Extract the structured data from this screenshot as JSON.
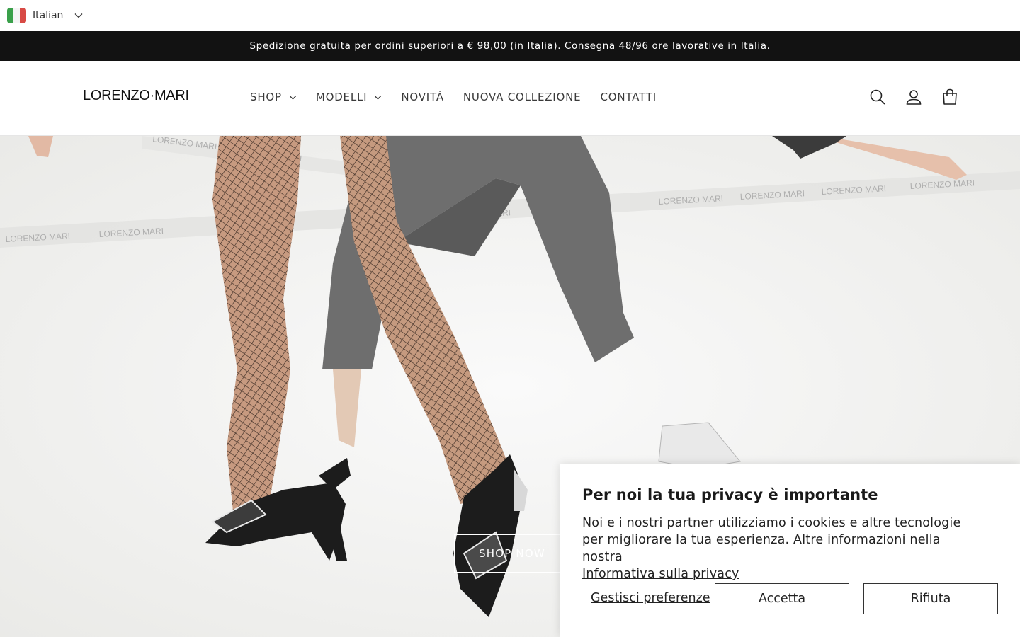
{
  "language": {
    "label": "Italian",
    "flag_colors": [
      "#3aa04a",
      "#f4f4f4",
      "#d84a45"
    ]
  },
  "announcement": {
    "text": "Spedizione gratuita per ordini superiori a € 98,00 (in Italia). Consegna 48/96 ore lavorative in Italia."
  },
  "header": {
    "logo": "LORENZO·MARI",
    "nav": [
      {
        "label": "SHOP",
        "has_dropdown": true
      },
      {
        "label": "MODELLI",
        "has_dropdown": true
      },
      {
        "label": "NOVITÀ",
        "has_dropdown": false
      },
      {
        "label": "NUOVA COLLEZIONE",
        "has_dropdown": false
      },
      {
        "label": "CONTATTI",
        "has_dropdown": false
      }
    ],
    "icons": [
      "search-icon",
      "account-icon",
      "cart-icon"
    ]
  },
  "hero": {
    "cta_label": "SHOP NOW",
    "tape_text": "LORENZO MARI"
  },
  "cookie_banner": {
    "title": "Per noi la tua privacy è importante",
    "body": "Noi e i nostri partner utilizziamo i cookies e altre tecnologie per migliorare la tua esperienza. Altre informazioni nella nostra",
    "link": "Informativa sulla privacy",
    "manage_label": "Gestisci preferenze",
    "accept_label": "Accetta",
    "reject_label": "Rifiuta"
  }
}
